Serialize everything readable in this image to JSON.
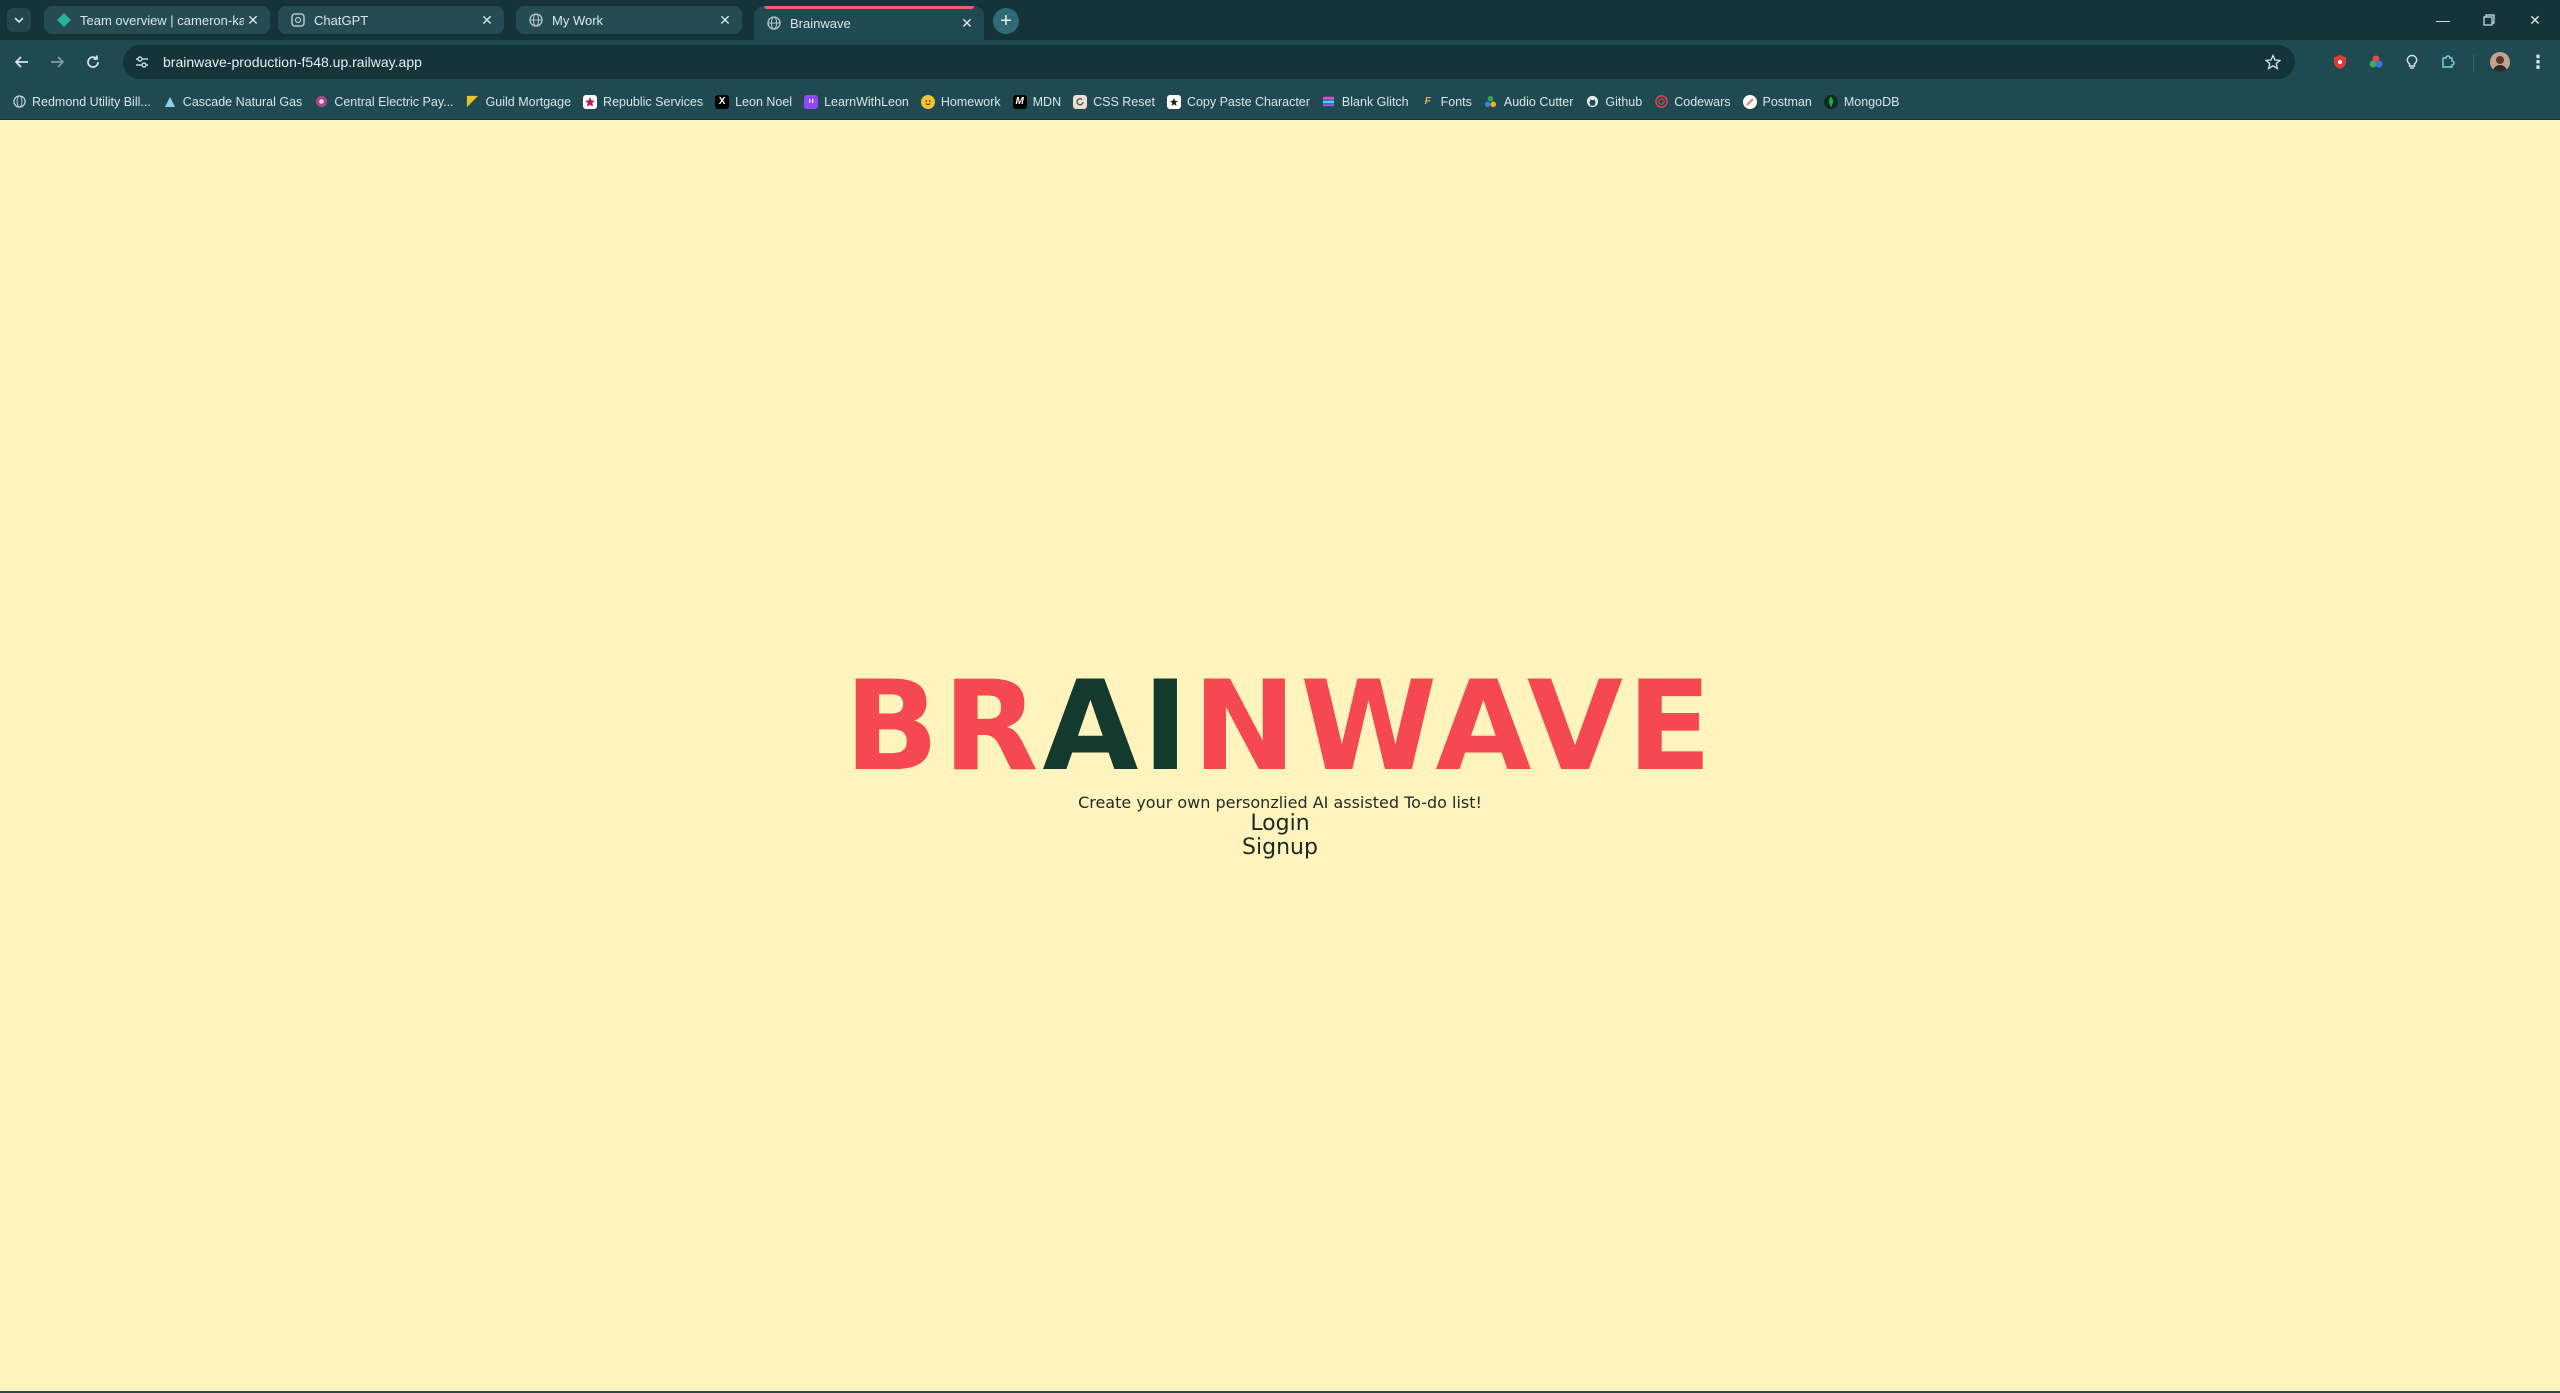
{
  "tabs": [
    {
      "title": "Team overview | cameron-kaub",
      "favicon": "railway-icon",
      "active": false
    },
    {
      "title": "ChatGPT",
      "favicon": "chatgpt-icon",
      "active": false
    },
    {
      "title": "My Work",
      "favicon": "globe-icon",
      "active": false
    },
    {
      "title": "Brainwave",
      "favicon": "globe-icon",
      "active": true
    }
  ],
  "toolbar": {
    "url": "brainwave-production-f548.up.railway.app"
  },
  "bookmarks": [
    {
      "label": "Redmond Utility Bill...",
      "icon": "globe-icon"
    },
    {
      "label": "Cascade Natural Gas",
      "icon": "cascade-icon"
    },
    {
      "label": "Central Electric Pay...",
      "icon": "electric-icon"
    },
    {
      "label": "Guild Mortgage",
      "icon": "guild-icon"
    },
    {
      "label": "Republic Services",
      "icon": "republic-icon"
    },
    {
      "label": "Leon Noel",
      "icon": "x-icon"
    },
    {
      "label": "LearnWithLeon",
      "icon": "twitch-icon"
    },
    {
      "label": "Homework",
      "icon": "homework-icon"
    },
    {
      "label": "MDN",
      "icon": "mdn-icon"
    },
    {
      "label": "CSS Reset",
      "icon": "css-reset-icon"
    },
    {
      "label": "Copy Paste Character",
      "icon": "copy-paste-icon"
    },
    {
      "label": "Blank Glitch",
      "icon": "glitch-icon"
    },
    {
      "label": "Fonts",
      "icon": "fonts-icon"
    },
    {
      "label": "Audio Cutter",
      "icon": "audio-cutter-icon"
    },
    {
      "label": "Github",
      "icon": "github-icon"
    },
    {
      "label": "Codewars",
      "icon": "codewars-icon"
    },
    {
      "label": "Postman",
      "icon": "postman-icon"
    },
    {
      "label": "MongoDB",
      "icon": "mongodb-icon"
    }
  ],
  "page": {
    "logo_part1": "BR",
    "logo_part2": "AI",
    "logo_part3": "NWAVE",
    "tagline": "Create your own personzlied AI assisted To-do list!",
    "login": "Login",
    "signup": "Signup"
  },
  "colors": {
    "page_bg": "#fff4bd",
    "logo_red": "#f54850",
    "logo_dark": "#133a2c",
    "chrome_dark": "#15343a",
    "chrome": "#1f4a52"
  }
}
